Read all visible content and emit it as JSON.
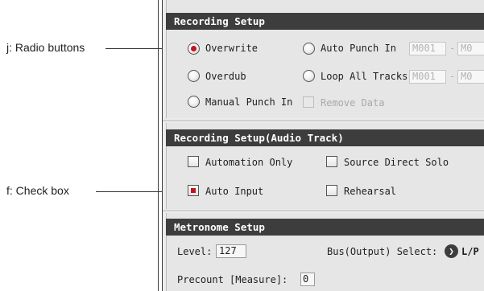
{
  "callouts": {
    "radio_buttons": "j: Radio buttons",
    "check_box": "f: Check box"
  },
  "recording_setup": {
    "title": "Recording Setup",
    "overwrite": "Overwrite",
    "auto_punch_in": "Auto Punch In",
    "overdub": "Overdub",
    "loop_all_tracks": "Loop All Tracks",
    "manual_punch_in": "Manual Punch In",
    "remove_data": "Remove Data",
    "punch_start_1": "M001",
    "punch_end_1": "M0",
    "loop_start": "M001",
    "loop_end": "M0",
    "separator": "-",
    "selected": "Overwrite"
  },
  "audio_track_setup": {
    "title": "Recording Setup(Audio Track)",
    "automation_only": "Automation Only",
    "source_direct_solo": "Source Direct Solo",
    "auto_input": "Auto Input",
    "rehearsal": "Rehearsal",
    "checked": [
      "Auto Input"
    ]
  },
  "metronome_setup": {
    "title": "Metronome Setup",
    "level_label": "Level:",
    "level_value": "127",
    "bus_label": "Bus(Output) Select:",
    "bus_value": "L/P",
    "bus_icon": "chevron-right-icon",
    "precount_label": "Precount [Measure]:",
    "precount_value": "0"
  },
  "colors": {
    "header_bg": "#3d3d3d",
    "panel_bg": "#ececec",
    "selected_accent": "#c4141c"
  }
}
